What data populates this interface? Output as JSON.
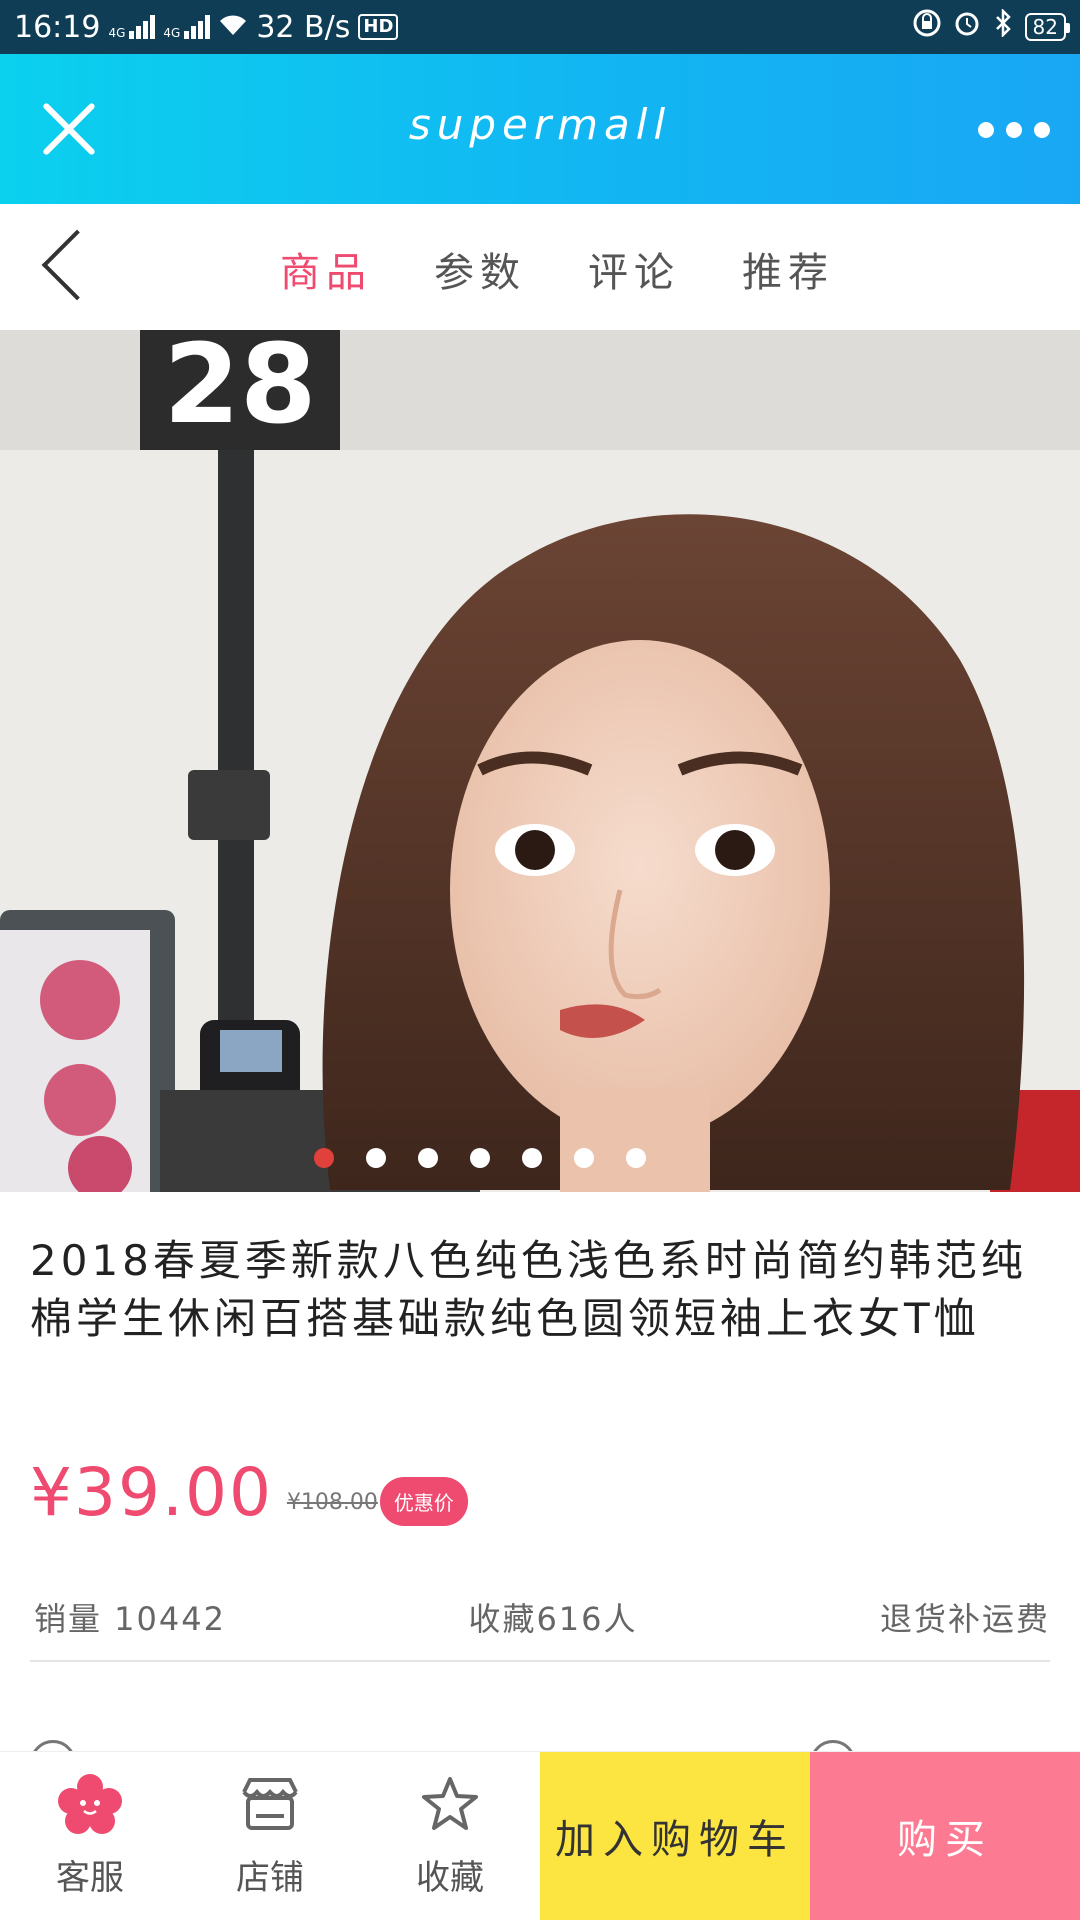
{
  "status_bar": {
    "time": "16:19",
    "network_1": "4G",
    "network_2": "4G",
    "speed": "32 B/s",
    "hd": "HD",
    "battery": "82"
  },
  "title_bar": {
    "title": "supermall"
  },
  "tabs": [
    {
      "label": "商品",
      "active": true
    },
    {
      "label": "参数",
      "active": false
    },
    {
      "label": "评论",
      "active": false
    },
    {
      "label": "推荐",
      "active": false
    }
  ],
  "carousel": {
    "slide_count": 7,
    "active_index": 0,
    "counter_number": "28"
  },
  "product": {
    "title": "2018春夏季新款八色纯色浅色系时尚简约韩范纯棉学生休闲百搭基础款纯色圆领短袖上衣女T恤",
    "price": "¥39.00",
    "old_price": "¥108.00",
    "badge": "优惠价"
  },
  "stats": {
    "sales": "销量 10442",
    "favorites": "收藏616人",
    "return": "退货补运费"
  },
  "bottom_bar": {
    "service": "客服",
    "shop": "店铺",
    "favorite": "收藏",
    "add_cart": "加入购物车",
    "buy": "购买"
  },
  "colors": {
    "accent": "#ef4a6f",
    "title_bar_start": "#0bd0ee",
    "title_bar_end": "#19a7f4",
    "add_cart_bg": "#fde541",
    "buy_bg": "#fc7b93",
    "active_dot": "#e0413a"
  }
}
